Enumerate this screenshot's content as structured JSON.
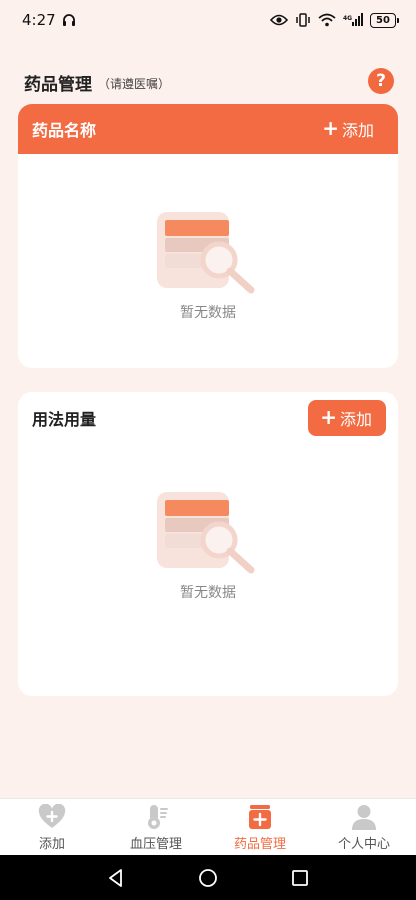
{
  "status_bar": {
    "time": "4:27",
    "battery": "50",
    "network": "4G"
  },
  "header": {
    "title": "药品管理",
    "subtitle": "（请遵医嘱）",
    "help_icon": "question-icon",
    "help_label": "?"
  },
  "medicine_card": {
    "title": "药品名称",
    "add_label": "添加",
    "empty_text": "暂无数据"
  },
  "usage_card": {
    "title": "用法用量",
    "add_label": "添加",
    "empty_text": "暂无数据"
  },
  "bottom_nav": {
    "items": [
      {
        "label": "添加",
        "icon": "heart-plus-icon",
        "active": false
      },
      {
        "label": "血压管理",
        "icon": "thermometer-icon",
        "active": false
      },
      {
        "label": "药品管理",
        "icon": "medicine-box-icon",
        "active": true
      },
      {
        "label": "个人中心",
        "icon": "person-icon",
        "active": false
      }
    ]
  },
  "colors": {
    "accent": "#f36b42",
    "background": "#fdf1ee",
    "inactive_icon": "#c9c9c9"
  }
}
